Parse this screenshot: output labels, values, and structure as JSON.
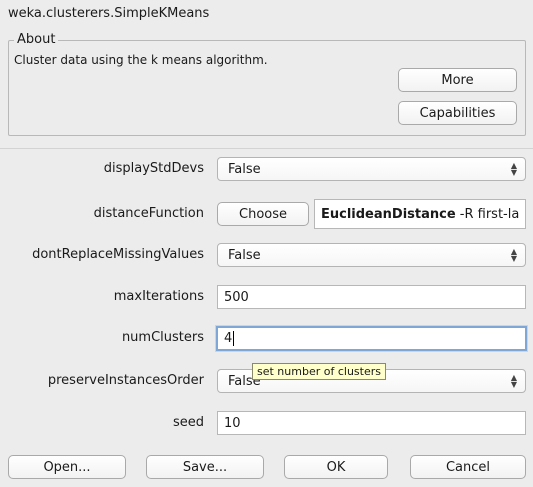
{
  "window_title": "weka.clusterers.SimpleKMeans",
  "about": {
    "legend": "About",
    "description": "Cluster data using the k means algorithm.",
    "more_label": "More",
    "capabilities_label": "Capabilities"
  },
  "properties": {
    "displayStdDevs": {
      "label": "displayStdDevs",
      "value": "False"
    },
    "distanceFunction": {
      "label": "distanceFunction",
      "choose_label": "Choose",
      "value_name": "EuclideanDistance",
      "value_args": "-R first-la"
    },
    "dontReplaceMissingValues": {
      "label": "dontReplaceMissingValues",
      "value": "False"
    },
    "maxIterations": {
      "label": "maxIterations",
      "value": "500"
    },
    "numClusters": {
      "label": "numClusters",
      "value": "4"
    },
    "preserveInstancesOrder": {
      "label": "preserveInstancesOrder",
      "value": "False"
    },
    "seed": {
      "label": "seed",
      "value": "10"
    }
  },
  "tooltip": "set number of clusters",
  "footer": {
    "open_label": "Open...",
    "save_label": "Save...",
    "ok_label": "OK",
    "cancel_label": "Cancel"
  },
  "icons": {
    "select_arrows": "up-down-arrows-icon"
  }
}
